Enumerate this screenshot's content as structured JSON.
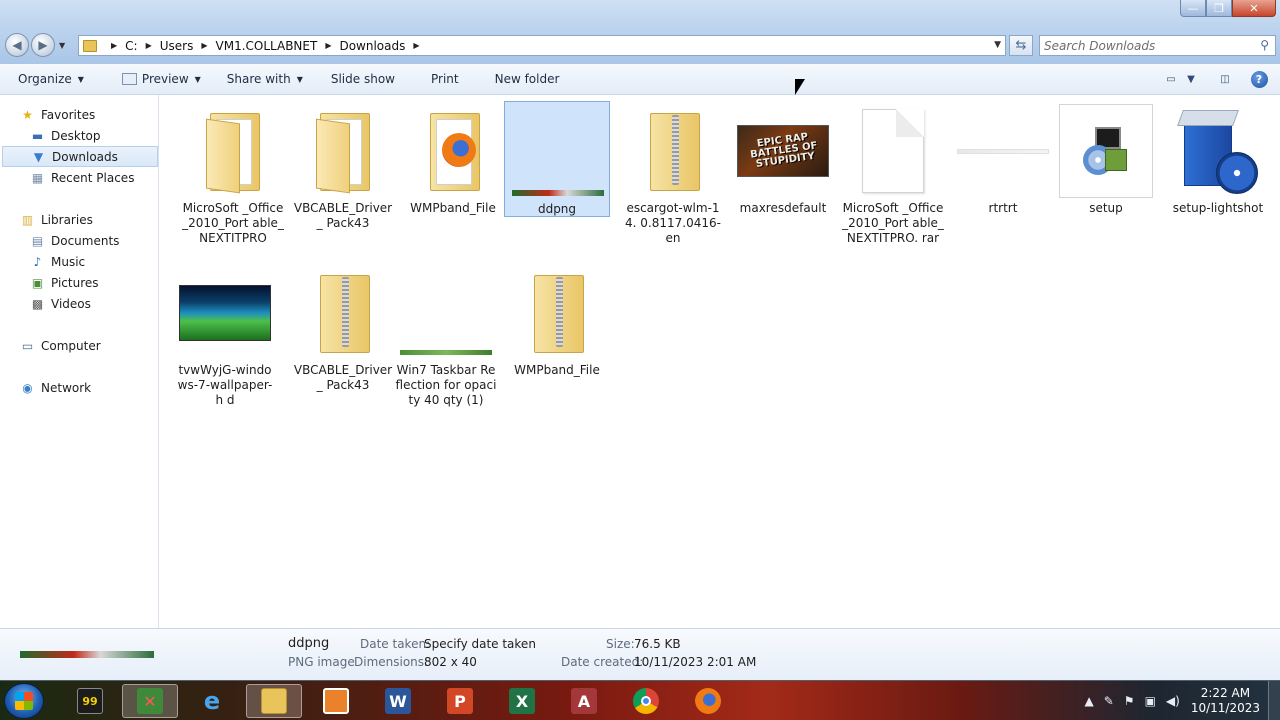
{
  "window": {
    "controls": {
      "minimize": "—",
      "maximize": "❐",
      "close": "✕"
    }
  },
  "address": {
    "crumbs": [
      "C:",
      "Users",
      "VM1.COLLABNET",
      "Downloads"
    ]
  },
  "search": {
    "placeholder": "Search Downloads"
  },
  "toolbar": {
    "organize": "Organize",
    "preview": "Preview",
    "share_with": "Share with",
    "slide_show": "Slide show",
    "print": "Print",
    "new_folder": "New folder"
  },
  "nav": {
    "favorites": "Favorites",
    "desktop": "Desktop",
    "downloads": "Downloads",
    "recent_places": "Recent Places",
    "libraries": "Libraries",
    "documents": "Documents",
    "music": "Music",
    "pictures": "Pictures",
    "videos": "Videos",
    "computer": "Computer",
    "network": "Network"
  },
  "files": [
    {
      "name": "MicroSoft _Office_2010_Port able_NEXTITPRO",
      "kind": "folder-docs"
    },
    {
      "name": "VBCABLE_Driver_ Pack43",
      "kind": "folder-docs"
    },
    {
      "name": "WMPband_File",
      "kind": "folder-firefox"
    },
    {
      "name": "ddpng",
      "kind": "png-strip",
      "selected": true
    },
    {
      "name": "escargot-wlm-14. 0.8117.0416-en",
      "kind": "zip-folder"
    },
    {
      "name": "maxresdefault",
      "kind": "image-rap",
      "image_text": "EPIC RAP BATTLES OF STUPIDITY"
    },
    {
      "name": "MicroSoft _Office_2010_Port able_NEXTITPRO. rar",
      "kind": "blank-doc"
    },
    {
      "name": "rtrtrt",
      "kind": "strip-light"
    },
    {
      "name": "setup",
      "kind": "setup-exe"
    },
    {
      "name": "setup-lightshot",
      "kind": "installer-box"
    },
    {
      "name": "tvwWyjG-windo ws-7-wallpaper-h d",
      "kind": "image-wallpaper"
    },
    {
      "name": "VBCABLE_Driver_ Pack43",
      "kind": "zip-folder"
    },
    {
      "name": "Win7 Taskbar Reflection for opacity 40 qty (1)",
      "kind": "strip-green"
    },
    {
      "name": "WMPband_File",
      "kind": "zip-folder"
    }
  ],
  "details": {
    "name": "ddpng",
    "type": "PNG image",
    "date_taken_label": "Date taken:",
    "date_taken_value": "Specify date taken",
    "dimensions_label": "Dimensions:",
    "dimensions_value": "802 x 40",
    "size_label": "Size:",
    "size_value": "76.5 KB",
    "date_created_label": "Date created:",
    "date_created_value": "10/11/2023 2:01 AM"
  },
  "taskbar": {
    "apps": [
      "cmd-app",
      "network-app",
      "internet-explorer",
      "windows-explorer",
      "media-app",
      "word",
      "powerpoint",
      "excel",
      "access",
      "chrome",
      "firefox"
    ],
    "app_glyphs": {
      "cmd": "99",
      "word": "W",
      "powerpoint": "P",
      "excel": "X",
      "access": "A"
    },
    "time": "2:22 AM",
    "date": "10/11/2023"
  }
}
